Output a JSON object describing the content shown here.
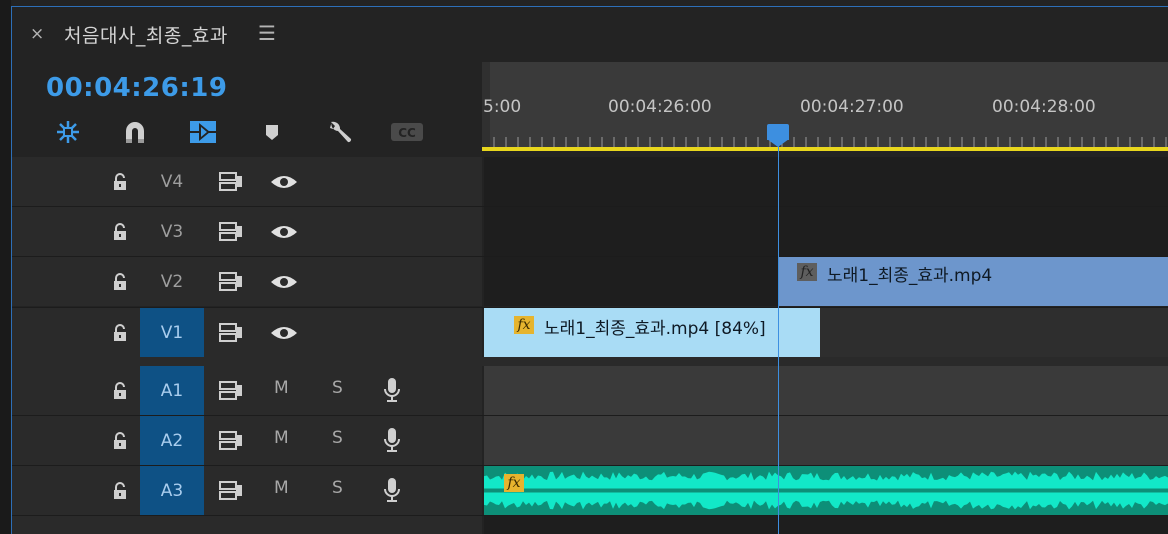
{
  "panel": {
    "close_glyph": "×",
    "title": "처음대사_최종_효과",
    "menu_glyph": "☰"
  },
  "timecode": "00:04:26:19",
  "toolbar": {
    "icons": [
      "nest-sequence-icon",
      "snap-magnet-icon",
      "linked-selection-icon",
      "add-marker-icon",
      "wrench-settings-icon",
      "captions-cc-icon"
    ],
    "cc_label": "CC"
  },
  "ruler": {
    "labels": [
      "5:00",
      "00:04:26:00",
      "00:04:27:00",
      "00:04:28:00"
    ]
  },
  "tracks": {
    "video": [
      {
        "name": "V4",
        "active": false
      },
      {
        "name": "V3",
        "active": false
      },
      {
        "name": "V2",
        "active": false
      },
      {
        "name": "V1",
        "active": true
      }
    ],
    "audio": [
      {
        "name": "A1",
        "mute": "M",
        "solo": "S",
        "active": true
      },
      {
        "name": "A2",
        "mute": "M",
        "solo": "S",
        "active": true
      },
      {
        "name": "A3",
        "mute": "M",
        "solo": "S",
        "active": true
      }
    ]
  },
  "clips": {
    "v2_clip": {
      "fx": "fx",
      "label": "노래1_최종_효과.mp4"
    },
    "v1_clip": {
      "fx": "fx",
      "label": "노래1_최종_효과.mp4 [84%]"
    },
    "a3_clip": {
      "fx": "fx"
    }
  },
  "colors": {
    "accent": "#3d9be8",
    "v2_clip": "#6d96cc",
    "v1_clip": "#a9dcf5",
    "audio_wave": "#12e8c8",
    "work_area": "#e8d61d",
    "active_track": "#0e5185"
  }
}
